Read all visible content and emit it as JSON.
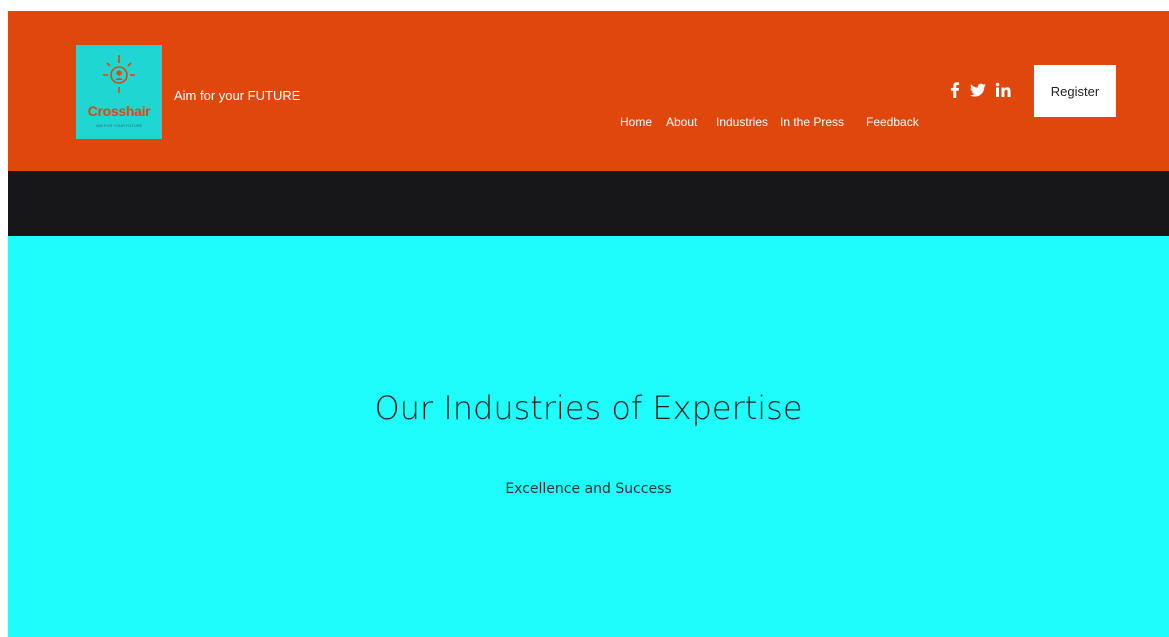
{
  "brand": {
    "logo_name": "Crosshair",
    "logo_tagline": "AIM FOR YOUR FUTURE",
    "tagline": "Aim for your FUTURE"
  },
  "nav": {
    "items": [
      {
        "label": "Home"
      },
      {
        "label": "About"
      },
      {
        "label": "Industries"
      },
      {
        "label": "In the Press"
      },
      {
        "label": "Feedback"
      }
    ],
    "register_label": "Register"
  },
  "social": {
    "icons": [
      "facebook-icon",
      "twitter-icon",
      "linkedin-icon"
    ]
  },
  "hero": {
    "title": "Our Industries of Expertise",
    "subtitle": "Excellence and Success"
  },
  "colors": {
    "header": "#e0470c",
    "dark_band": "#171719",
    "hero": "#1efcfc",
    "logo_bg": "#1fd6d3"
  }
}
